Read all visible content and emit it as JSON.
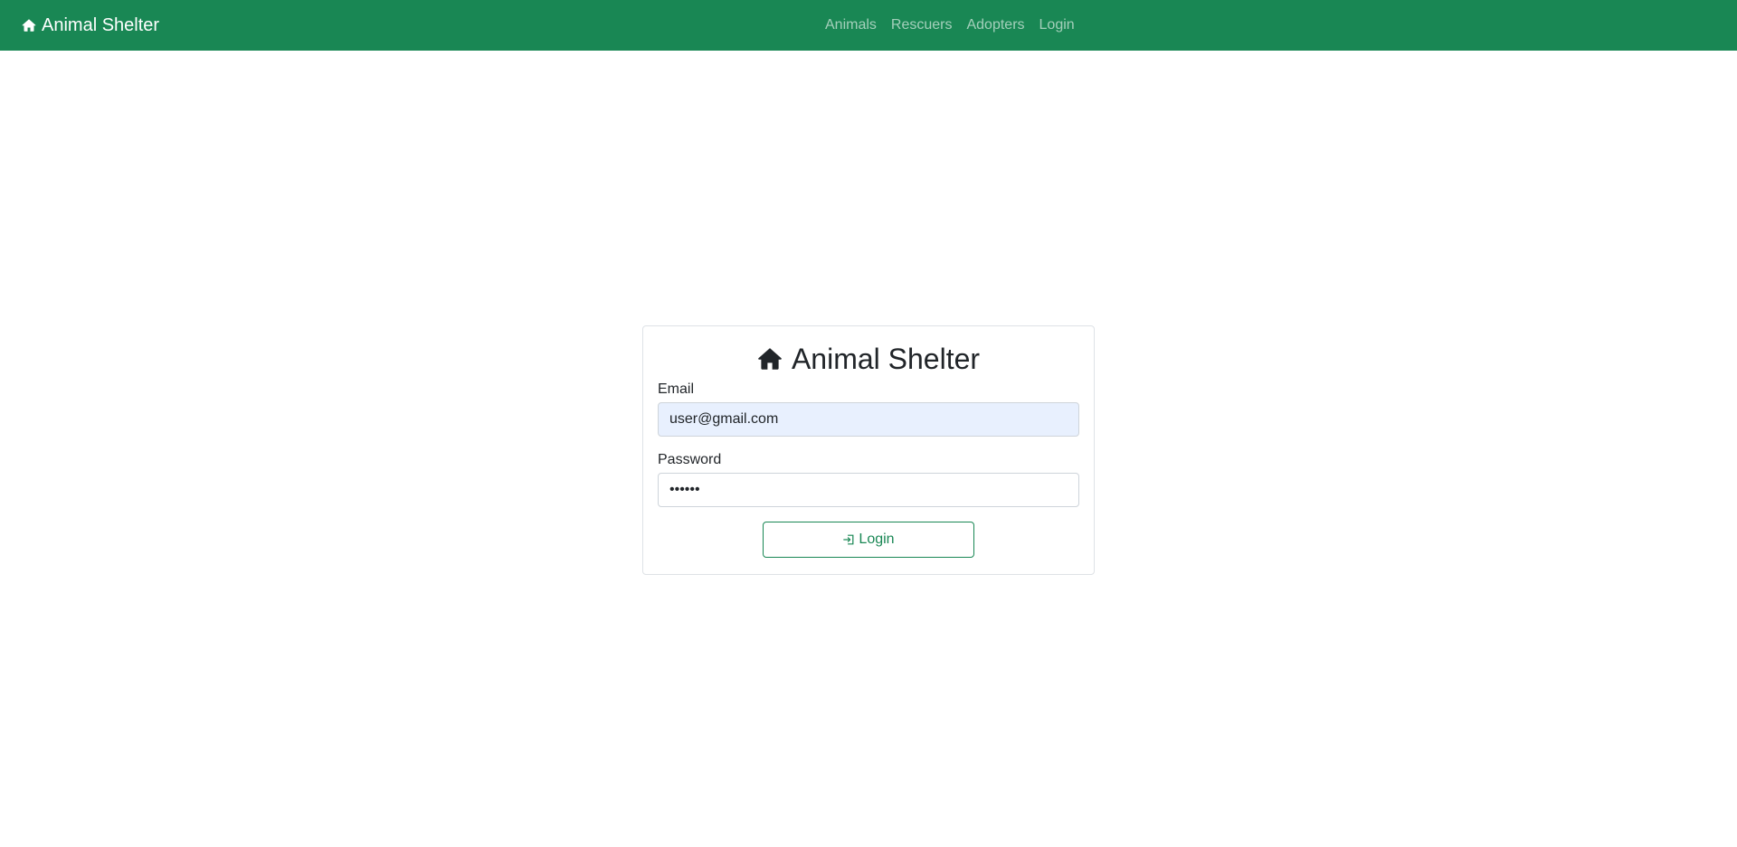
{
  "navbar": {
    "brand_icon": "house-icon",
    "brand_label": "Animal Shelter",
    "links": [
      {
        "label": "Animals"
      },
      {
        "label": "Rescuers"
      },
      {
        "label": "Adopters"
      },
      {
        "label": "Login"
      }
    ],
    "background_color": "#198754"
  },
  "login_card": {
    "title_icon": "house-icon",
    "title": "Animal Shelter",
    "email": {
      "label": "Email",
      "value": "user@gmail.com"
    },
    "password": {
      "label": "Password",
      "value": "••••••"
    },
    "submit": {
      "icon": "login-arrow-icon",
      "label": "Login"
    }
  },
  "colors": {
    "accent": "#198754",
    "autofill": "#e8f0fe"
  }
}
